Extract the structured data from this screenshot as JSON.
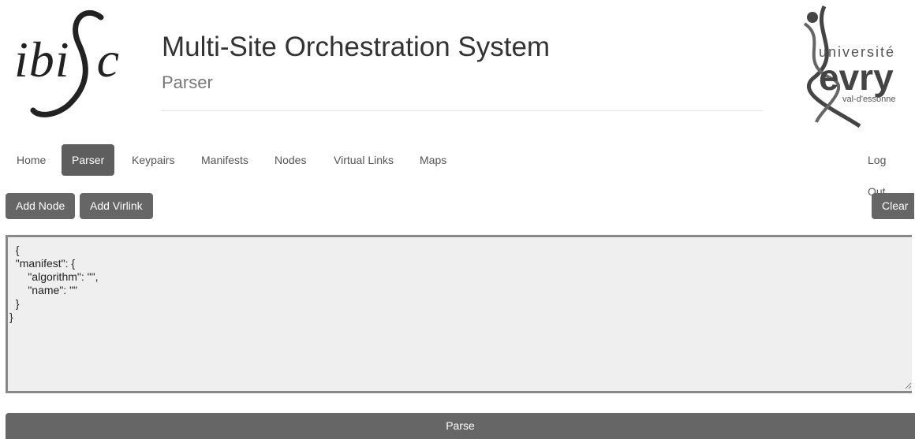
{
  "header": {
    "logo_left_text": "ibi",
    "logo_left_letter": "c",
    "title": "Multi-Site Orchestration System",
    "subtitle": "Parser",
    "logo_right": {
      "line1": "université",
      "line2": "evry",
      "line3": "val-d'essonne"
    }
  },
  "nav": {
    "items": [
      {
        "label": "Home",
        "active": false
      },
      {
        "label": "Parser",
        "active": true
      },
      {
        "label": "Keypairs",
        "active": false
      },
      {
        "label": "Manifests",
        "active": false
      },
      {
        "label": "Nodes",
        "active": false
      },
      {
        "label": "Virtual Links",
        "active": false
      },
      {
        "label": "Maps",
        "active": false
      }
    ],
    "logout_label": "Log Out"
  },
  "toolbar": {
    "add_node_label": "Add Node",
    "add_virlink_label": "Add Virlink",
    "clear_label": "Clear"
  },
  "editor": {
    "content": "  {\n  \"manifest\": {\n      \"algorithm\": \"\",\n      \"name\": \"\"\n  }\n}"
  },
  "parse_label": "Parse",
  "colors": {
    "button_bg": "#666666",
    "nav_active_bg": "#5e5e5e"
  }
}
